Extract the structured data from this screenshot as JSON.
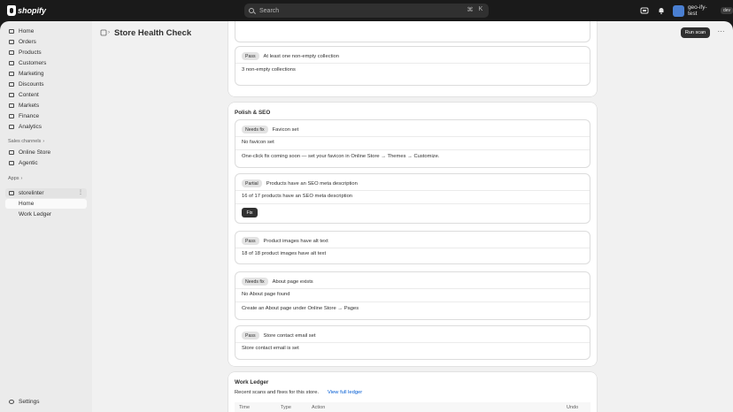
{
  "topbar": {
    "brand": "shopify",
    "search_placeholder": "Search",
    "shortcut_mod": "⌘",
    "shortcut_key": "K",
    "store_name": "geo-ify-test",
    "store_badge": "dev",
    "avatar_color": "#4a7fd1"
  },
  "sidebar": {
    "items": [
      {
        "label": "Home"
      },
      {
        "label": "Orders"
      },
      {
        "label": "Products"
      },
      {
        "label": "Customers"
      },
      {
        "label": "Marketing"
      },
      {
        "label": "Discounts"
      },
      {
        "label": "Content"
      },
      {
        "label": "Markets"
      },
      {
        "label": "Finance"
      },
      {
        "label": "Analytics"
      }
    ],
    "sales_channels_label": "Sales channels",
    "channels": [
      {
        "label": "Online Store"
      },
      {
        "label": "Agentic"
      }
    ],
    "apps_label": "Apps",
    "app_name": "storelinter",
    "app_sub_items": [
      {
        "label": "Home"
      },
      {
        "label": "Work Ledger"
      }
    ],
    "settings_label": "Settings"
  },
  "page": {
    "title": "Store Health Check",
    "run_scan_label": "Run scan"
  },
  "collections_check": {
    "badge": "Pass",
    "title": "At least one non-empty collection",
    "detail": "3 non-empty collections"
  },
  "polish_seo": {
    "section_title": "Polish & SEO",
    "checks": [
      {
        "badge": "Needs fix",
        "title": "Favicon set",
        "detail": "No favicon set",
        "hint": "One-click fix coming soon — set your favicon in Online Store → Themes → Customize."
      },
      {
        "badge": "Partial",
        "title": "Products have an SEO meta description",
        "detail": "16 of 17 products have an SEO meta description",
        "action": "Fix"
      },
      {
        "badge": "Pass",
        "title": "Product images have alt text",
        "detail": "18 of 18 product images have alt text"
      },
      {
        "badge": "Needs fix",
        "title": "About page exists",
        "detail": "No About page found",
        "hint": "Create an About page under Online Store → Pages"
      },
      {
        "badge": "Pass",
        "title": "Store contact email set",
        "detail": "Store contact email is set"
      }
    ]
  },
  "work_ledger": {
    "title": "Work Ledger",
    "subtitle": "Recent scans and fixes for this store.",
    "view_link": "View full ledger",
    "columns": [
      "Time",
      "Type",
      "Action",
      "Undo"
    ]
  },
  "colors": {
    "accent_dark": "#303030",
    "link": "#005bd3",
    "topbar_bg": "#1a1a1a"
  }
}
